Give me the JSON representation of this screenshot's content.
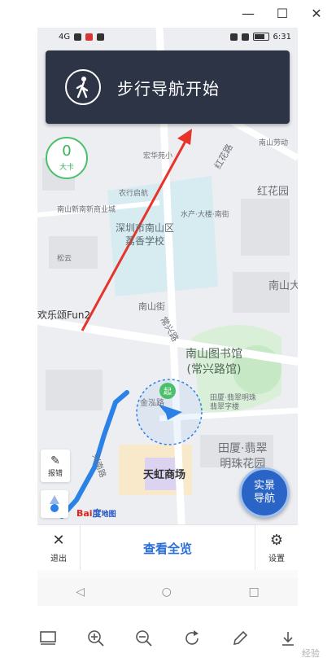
{
  "statusbar": {
    "time": "6:31",
    "signal": "4G"
  },
  "banner": {
    "text": "步行导航开始"
  },
  "calorie": {
    "value": "0",
    "unit": "大卡"
  },
  "map_labels": {
    "school": "深圳市南山区\n荔香学校",
    "library": "南山图书馆\n(常兴路馆)",
    "mall": "天虹商场",
    "apartment": "田厦·翡翠\n明珠花园",
    "hongling": "红花园",
    "nanshan": "南山大",
    "nanshan_street": "南山街",
    "changxing": "常兴路",
    "hong_road": "红花路",
    "fun": "欢乐颂Fun2",
    "nanxin": "南山新南新商业城",
    "nonghang": "农行启航",
    "shuxin": "水产·大楼·南街",
    "jin": "金泓路",
    "tianxia": "田厦·翡翠明珠\n翡翠字楼",
    "xingnan": "兴南路",
    "nanshan_labor": "南山劳动",
    "hongshan": "宏华苑小",
    "songyuan": "松云"
  },
  "buttons": {
    "report": "报错",
    "ar_nav_line1": "实景",
    "ar_nav_line2": "导航",
    "exit": "退出",
    "overview": "查看全览",
    "settings": "设置"
  },
  "logo": {
    "part1": "Bai",
    "part2": "度",
    "part3": "地图"
  },
  "start_marker": "起",
  "watermark": "经验",
  "colors": {
    "banner_bg": "#2c3446",
    "route_blue": "#2b82e6",
    "arrow_red": "#e8332a",
    "accent_green": "#3bb05a"
  }
}
